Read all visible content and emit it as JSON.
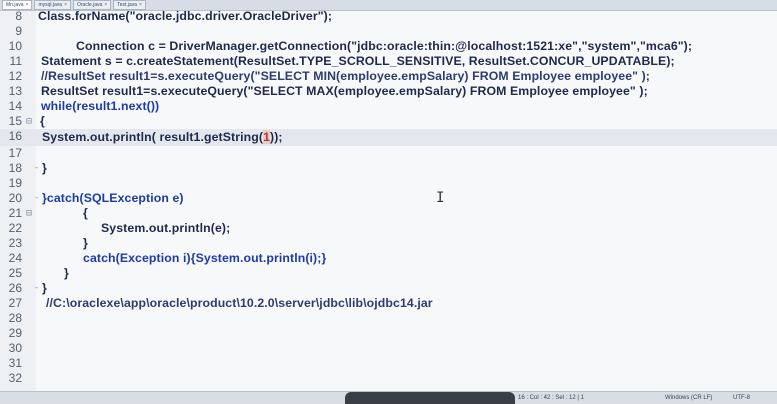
{
  "tabs": [
    {
      "label": "Mn.java",
      "active": true
    },
    {
      "label": "mysql.java",
      "active": false
    },
    {
      "label": "Oracle.java",
      "active": false
    },
    {
      "label": "Test.java",
      "active": false
    }
  ],
  "lines": [
    {
      "n": "8",
      "text": "Class.forName(\"oracle.jdbc.driver.OracleDriver\");"
    },
    {
      "n": "9",
      "text": ""
    },
    {
      "n": "10",
      "text": "Connection c = DriverManager.getConnection(\"jdbc:oracle:thin:@localhost:1521:xe\",\"system\",\"mca6\");"
    },
    {
      "n": "11",
      "text": "Statement s = c.createStatement(ResultSet.TYPE_SCROLL_SENSITIVE, ResultSet.CONCUR_UPDATABLE);"
    },
    {
      "n": "12",
      "text": "//ResultSet result1=s.executeQuery(\"SELECT MIN(employee.empSalary) FROM Employee employee\" );"
    },
    {
      "n": "13",
      "text": "ResultSet result1=s.executeQuery(\"SELECT MAX(employee.empSalary) FROM Employee employee\" );"
    },
    {
      "n": "14",
      "text": "while(result1.next())"
    },
    {
      "n": "15",
      "text": "{"
    },
    {
      "n": "16",
      "text_a": "System.out.println( result1.getString(",
      "text_b": "1",
      "text_c": "));"
    },
    {
      "n": "17",
      "text": ""
    },
    {
      "n": "18",
      "text": "}"
    },
    {
      "n": "19",
      "text": ""
    },
    {
      "n": "20",
      "text": "}catch(SQLException e)"
    },
    {
      "n": "21",
      "text": "{"
    },
    {
      "n": "22",
      "text": "System.out.println(e);"
    },
    {
      "n": "23",
      "text": "}"
    },
    {
      "n": "24",
      "text": "catch(Exception i){System.out.println(i);}"
    },
    {
      "n": "25",
      "text": "}"
    },
    {
      "n": "26",
      "text": "}"
    },
    {
      "n": "27",
      "text": "//C:\\oraclexe\\app\\oracle\\product\\10.2.0\\server\\jdbc\\lib\\ojdbc14.jar"
    },
    {
      "n": "28",
      "text": ""
    },
    {
      "n": "29",
      "text": ""
    },
    {
      "n": "30",
      "text": ""
    },
    {
      "n": "31",
      "text": ""
    },
    {
      "n": "32",
      "text": ""
    }
  ],
  "status": {
    "position": "16 : Col : 42 : Sel : 12 | 1",
    "line_ending": "Windows (CR LF)",
    "encoding": "UTF-8"
  }
}
